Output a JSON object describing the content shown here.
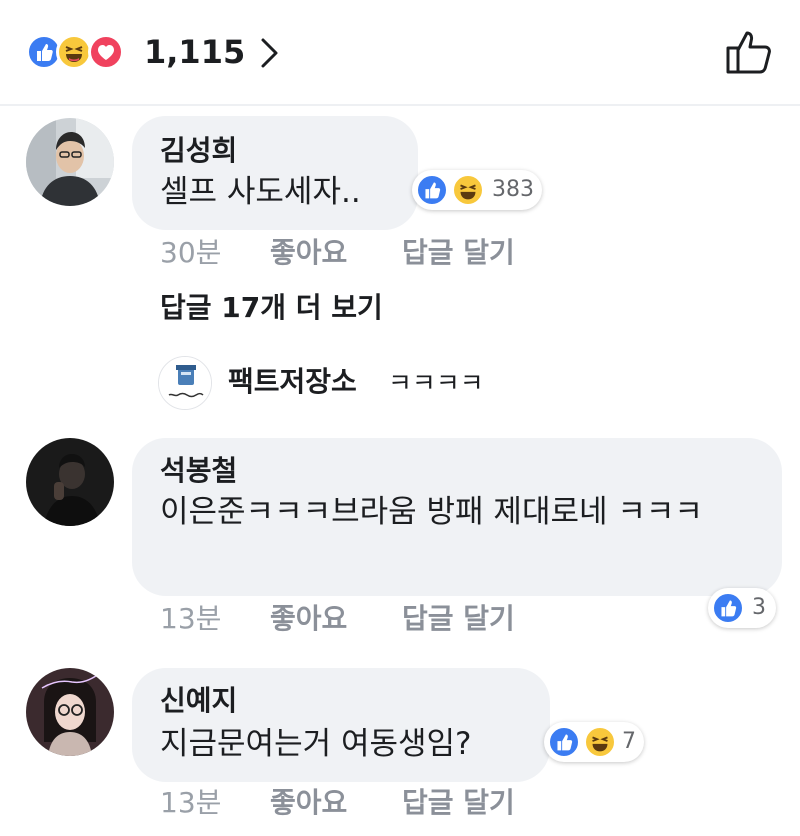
{
  "header": {
    "reaction_icons": [
      "like-icon",
      "haha-icon",
      "love-icon"
    ],
    "total_count": "1,115",
    "like_button_icon": "thumbs-up-outline-icon"
  },
  "colors": {
    "like_blue": "#3b7cf2",
    "haha_yellow": "#f8c83c",
    "love_red": "#f0425e",
    "bubble_gray": "#f0f2f5"
  },
  "comments": [
    {
      "author": "김성희",
      "text": "셀프 사도세자..",
      "time": "30분",
      "like_label": "좋아요",
      "reply_label": "답글 달기",
      "reactions": [
        "like-icon",
        "haha-icon"
      ],
      "reaction_count": "383"
    },
    {
      "author": "석봉철",
      "text": "이은준ㅋㅋㅋ브라움 방패 제대로네 ㅋㅋㅋ",
      "time": "13분",
      "like_label": "좋아요",
      "reply_label": "답글 달기",
      "reactions": [
        "like-icon"
      ],
      "reaction_count": "3"
    },
    {
      "author": "신예지",
      "text": "지금문여는거 여동생임?",
      "time": "13분",
      "like_label": "좋아요",
      "reply_label": "답글 달기",
      "reactions": [
        "like-icon",
        "haha-icon"
      ],
      "reaction_count": "7"
    }
  ],
  "replies": {
    "more_label": "답글 17개 더 보기",
    "preview": {
      "author": "팩트저장소",
      "text": "ㅋㅋㅋㅋ"
    }
  }
}
